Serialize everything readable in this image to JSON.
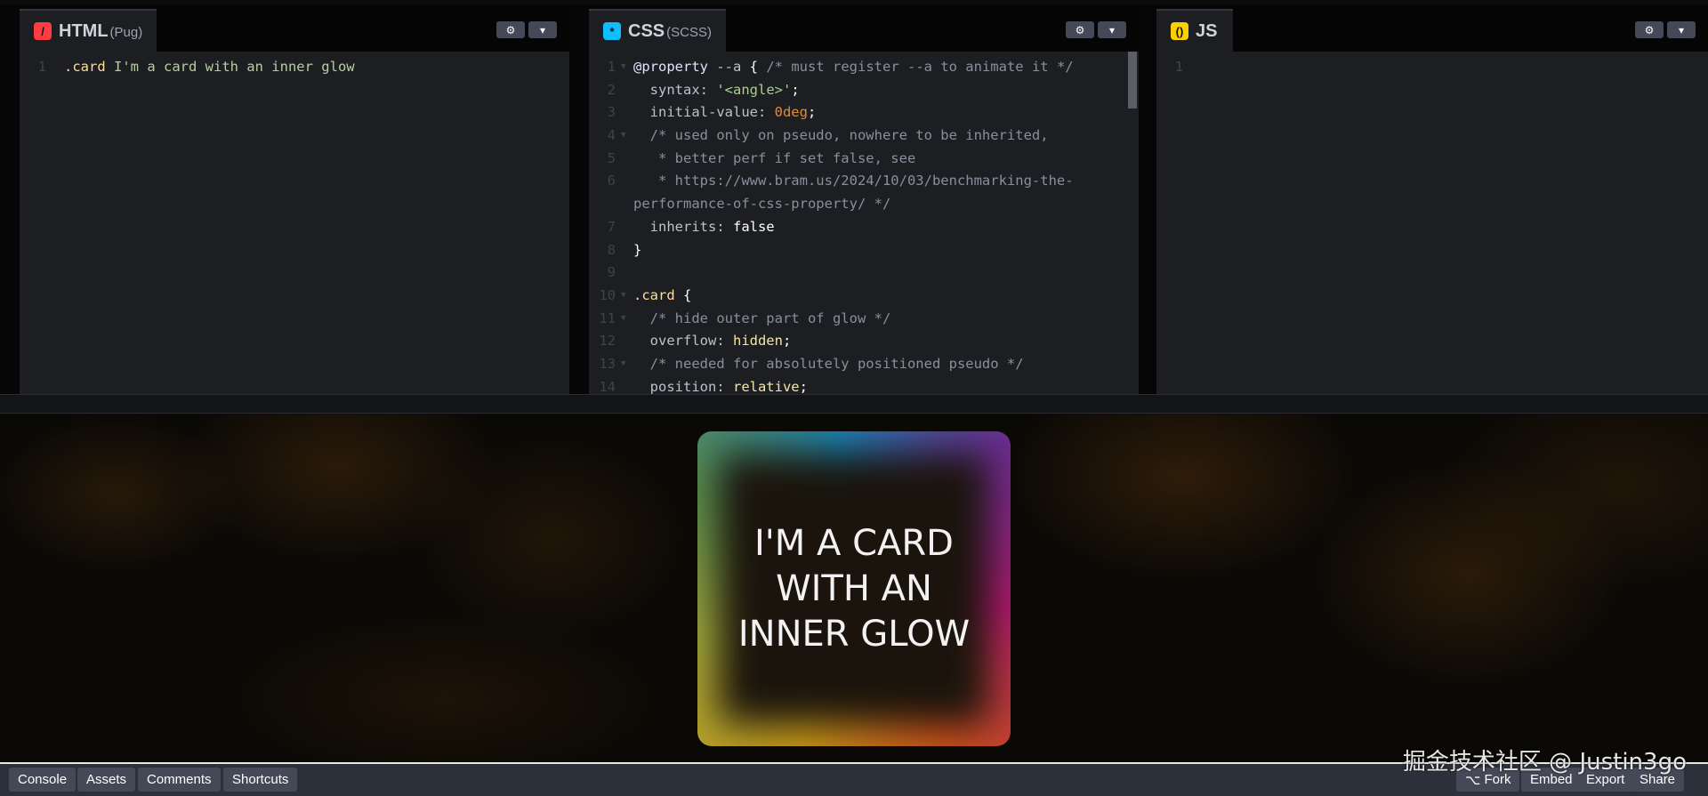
{
  "panels": [
    {
      "id": "html",
      "title": "HTML",
      "sub": "(Pug)",
      "badge": "/",
      "badge_color": "#ff3c41",
      "lines": [
        {
          "n": "1",
          "t": [
            [
              ".card",
              "sel"
            ],
            [
              " I'm a card with an inner glow",
              "txt"
            ]
          ]
        }
      ]
    },
    {
      "id": "css",
      "title": "CSS",
      "sub": "(SCSS)",
      "badge": "*",
      "badge_color": "#0ebeff",
      "lines": [
        {
          "n": "1",
          "f": true,
          "t": [
            [
              "@property",
              "at"
            ],
            [
              " --a ",
              "def"
            ],
            [
              "{",
              "pun"
            ],
            [
              " /* must register --a to animate it */",
              "com"
            ]
          ]
        },
        {
          "n": "2",
          "t": [
            [
              "  syntax: ",
              "def"
            ],
            [
              "'<angle>'",
              "str"
            ],
            [
              ";",
              "pun"
            ]
          ]
        },
        {
          "n": "3",
          "t": [
            [
              "  initial-value: ",
              "def"
            ],
            [
              "0deg",
              "num"
            ],
            [
              ";",
              "pun"
            ]
          ]
        },
        {
          "n": "4",
          "f": true,
          "t": [
            [
              "  /* used only on pseudo, nowhere to be inherited,",
              "com"
            ]
          ]
        },
        {
          "n": "5",
          "t": [
            [
              "   * better perf if set false, see",
              "com"
            ]
          ]
        },
        {
          "n": "6",
          "t": [
            [
              "   * https://www.bram.us/2024/10/03/benchmarking-the-",
              "com"
            ]
          ]
        },
        {
          "n": "",
          "t": [
            [
              "performance-of-css-property/ */",
              "com"
            ]
          ]
        },
        {
          "n": "7",
          "t": [
            [
              "  inherits: ",
              "def"
            ],
            [
              "false",
              "bool"
            ]
          ]
        },
        {
          "n": "8",
          "t": [
            [
              "}",
              "pun"
            ]
          ]
        },
        {
          "n": "9",
          "t": []
        },
        {
          "n": "10",
          "f": true,
          "t": [
            [
              ".card",
              "sel"
            ],
            [
              " {",
              "pun"
            ]
          ]
        },
        {
          "n": "11",
          "f": true,
          "t": [
            [
              "  /* hide outer part of glow */",
              "com"
            ]
          ]
        },
        {
          "n": "12",
          "t": [
            [
              "  overflow: ",
              "def"
            ],
            [
              "hidden",
              "val"
            ],
            [
              ";",
              "pun"
            ]
          ]
        },
        {
          "n": "13",
          "f": true,
          "t": [
            [
              "  /* needed for absolutely positioned pseudo */",
              "com"
            ]
          ]
        },
        {
          "n": "14",
          "t": [
            [
              "  position: ",
              "def"
            ],
            [
              "relative",
              "val"
            ],
            [
              ";",
              "pun"
            ]
          ]
        }
      ]
    },
    {
      "id": "js",
      "title": "JS",
      "sub": "",
      "badge": "()",
      "badge_color": "#fcd000",
      "lines": [
        {
          "n": "1",
          "t": []
        }
      ]
    }
  ],
  "panel_icons": [
    "gear-icon",
    "chevron-down-icon"
  ],
  "preview": {
    "card_text": "I'M A CARD WITH AN INNER GLOW"
  },
  "footer": {
    "left": [
      "Console",
      "Assets",
      "Comments",
      "Shortcuts"
    ],
    "fork": "Fork",
    "right": [
      "Embed",
      "Export",
      "Share"
    ]
  },
  "watermark": "掘金技术社区 @ Justin3go"
}
